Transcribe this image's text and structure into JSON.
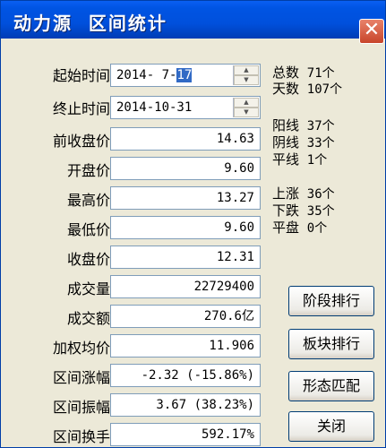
{
  "window": {
    "title": "动力源  区间统计",
    "close_glyph": "✕"
  },
  "fields": {
    "start_date": {
      "label": "起始时间",
      "value_prefix": "2014- 7-",
      "value_selected": "17"
    },
    "end_date": {
      "label": "终止时间",
      "value": "2014-10-31"
    },
    "rows": [
      {
        "label": "前收盘价",
        "value": "14.63"
      },
      {
        "label": "开盘价",
        "value": "9.60"
      },
      {
        "label": "最高价",
        "value": "13.27"
      },
      {
        "label": "最低价",
        "value": "9.60"
      },
      {
        "label": "收盘价",
        "value": "12.31"
      },
      {
        "label": "成交量",
        "value": "22729400"
      },
      {
        "label": "成交额",
        "value": "270.6亿"
      },
      {
        "label": "加权均价",
        "value": "11.906"
      },
      {
        "label": "区间涨幅",
        "value": "-2.32 (-15.86%)"
      },
      {
        "label": "区间振幅",
        "value": "3.67 (38.23%)"
      },
      {
        "label": "区间换手",
        "value": "592.17%"
      }
    ]
  },
  "stats": [
    {
      "label": "总数",
      "value": "71个"
    },
    {
      "label": "天数",
      "value": "107个"
    },
    {
      "label": "阳线",
      "value": "37个"
    },
    {
      "label": "阴线",
      "value": "33个"
    },
    {
      "label": "平线",
      "value": "1个"
    },
    {
      "label": "上涨",
      "value": "36个"
    },
    {
      "label": "下跌",
      "value": "35个"
    },
    {
      "label": "平盘",
      "value": "0个"
    }
  ],
  "buttons": {
    "stage_rank": "阶段排行",
    "sector_rank": "板块排行",
    "pattern_match": "形态匹配",
    "close": "关闭"
  }
}
